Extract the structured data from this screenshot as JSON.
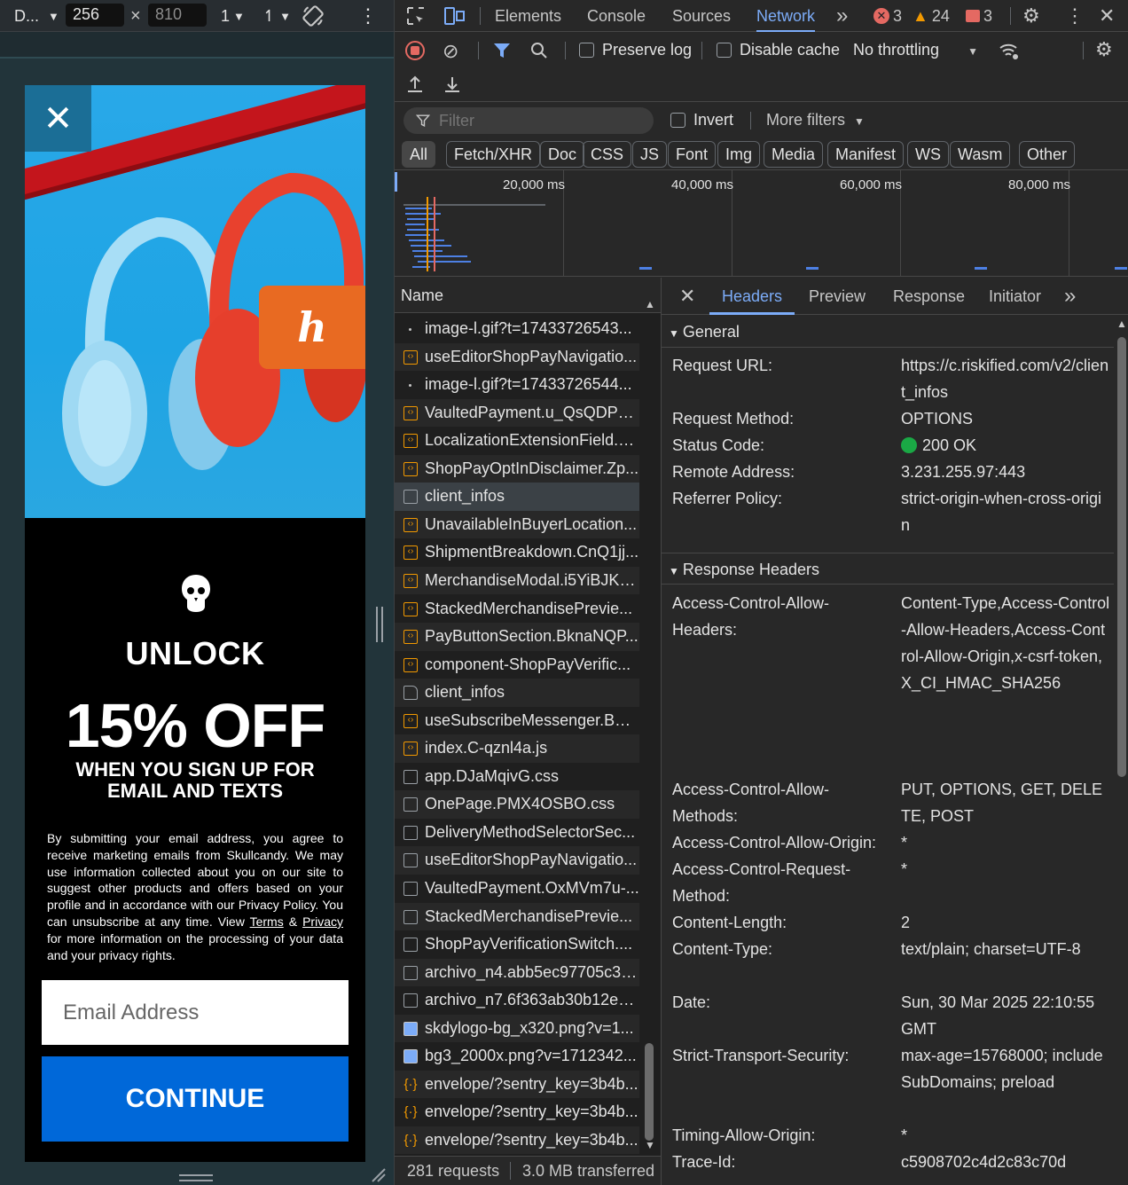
{
  "device_toolbar": {
    "device": "D...",
    "width": "256",
    "height": "810",
    "zoom": "1",
    "throttle": "↿"
  },
  "promo": {
    "close": "✕",
    "unlock": "UNLOCK",
    "offer": "15% OFF",
    "signup_line1": "WHEN YOU SIGN UP FOR",
    "signup_line2": "EMAIL AND TEXTS",
    "legal_part1": "By submitting your email address, you agree to receive marketing emails from Skullcandy. We may use information collected about you on our site to suggest other products and offers based on your profile and in accordance with our Privacy Policy. You can unsubscribe at any time. View ",
    "terms": "Terms",
    "amp": " & ",
    "privacy": "Privacy",
    "legal_part2": " for more information on the processing of your data and your privacy rights.",
    "email_placeholder": "Email Address",
    "continue": "CONTINUE",
    "honey_logo": "h"
  },
  "tabs": {
    "elements": "Elements",
    "console": "Console",
    "sources": "Sources",
    "network": "Network",
    "more": "»",
    "errors": "3",
    "warnings": "24",
    "issues": "3"
  },
  "toolbar": {
    "preserve_log": "Preserve log",
    "disable_cache": "Disable cache",
    "throttling": "No throttling"
  },
  "filter": {
    "placeholder": "Filter",
    "invert": "Invert",
    "more_filters": "More filters"
  },
  "chips": [
    "All",
    "Fetch/XHR",
    "Doc",
    "CSS",
    "JS",
    "Font",
    "Img",
    "Media",
    "Manifest",
    "WS",
    "Wasm",
    "Other"
  ],
  "timeline": {
    "labels": [
      "20,000 ms",
      "40,000 ms",
      "60,000 ms",
      "80,000 ms"
    ]
  },
  "request_list": {
    "header": "Name",
    "items": [
      {
        "name": "image-l.gif?t=17433726543...",
        "type": "dot"
      },
      {
        "name": "useEditorShopPayNavigatio...",
        "type": "script"
      },
      {
        "name": "image-l.gif?t=17433726544...",
        "type": "dot"
      },
      {
        "name": "VaultedPayment.u_QsQDPg.js",
        "type": "script"
      },
      {
        "name": "LocalizationExtensionField.D...",
        "type": "script"
      },
      {
        "name": "ShopPayOptInDisclaimer.Zp...",
        "type": "script"
      },
      {
        "name": "client_infos",
        "type": "doc"
      },
      {
        "name": "UnavailableInBuyerLocation...",
        "type": "script"
      },
      {
        "name": "ShipmentBreakdown.CnQ1jj...",
        "type": "script"
      },
      {
        "name": "MerchandiseModal.i5YiBJKZ...",
        "type": "script"
      },
      {
        "name": "StackedMerchandisePrevie...",
        "type": "script"
      },
      {
        "name": "PayButtonSection.BknaNQP...",
        "type": "script"
      },
      {
        "name": "component-ShopPayVerific...",
        "type": "script"
      },
      {
        "name": "client_infos",
        "type": "file"
      },
      {
        "name": "useSubscribeMessenger.BC...",
        "type": "script"
      },
      {
        "name": "index.C-qznl4a.js",
        "type": "script"
      },
      {
        "name": "app.DJaMqivG.css",
        "type": "doc"
      },
      {
        "name": "OnePage.PMX4OSBO.css",
        "type": "doc"
      },
      {
        "name": "DeliveryMethodSelectorSec...",
        "type": "doc"
      },
      {
        "name": "useEditorShopPayNavigatio...",
        "type": "doc"
      },
      {
        "name": "VaultedPayment.OxMVm7u-...",
        "type": "doc"
      },
      {
        "name": "StackedMerchandisePrevie...",
        "type": "doc"
      },
      {
        "name": "ShopPayVerificationSwitch....",
        "type": "doc"
      },
      {
        "name": "archivo_n4.abb5ec97705c33...",
        "type": "doc"
      },
      {
        "name": "archivo_n7.6f363ab30b12ea...",
        "type": "doc"
      },
      {
        "name": "skdylogo-bg_x320.png?v=1...",
        "type": "img"
      },
      {
        "name": "bg3_2000x.png?v=1712342...",
        "type": "img"
      },
      {
        "name": "envelope/?sentry_key=3b4b...",
        "type": "json"
      },
      {
        "name": "envelope/?sentry_key=3b4b...",
        "type": "json"
      },
      {
        "name": "envelope/?sentry_key=3b4b...",
        "type": "json"
      }
    ]
  },
  "status": {
    "requests": "281 requests",
    "transferred": "3.0 MB transferred"
  },
  "detail_tabs": {
    "close": "✕",
    "headers": "Headers",
    "preview": "Preview",
    "response": "Response",
    "initiator": "Initiator",
    "more": "»"
  },
  "general": {
    "title": "General",
    "rows": [
      {
        "k": "Request URL:",
        "v": "https://c.riskified.com/v2/client_infos"
      },
      {
        "k": "Request Method:",
        "v": "OPTIONS"
      },
      {
        "k": "Status Code:",
        "v": "200 OK"
      },
      {
        "k": "Remote Address:",
        "v": "3.231.255.97:443"
      },
      {
        "k": "Referrer Policy:",
        "v": "strict-origin-when-cross-origin"
      }
    ]
  },
  "response_headers": {
    "title": "Response Headers",
    "rows": [
      {
        "k": "Access-Control-Allow-Headers:",
        "v": "Content-Type,Access-Control-Allow-Headers,Access-Control-Allow-Origin,x-csrf-token,X_CI_HMAC_SHA256"
      },
      {
        "k": "Access-Control-Allow-Methods:",
        "v": "PUT, OPTIONS, GET, DELETE, POST"
      },
      {
        "k": "Access-Control-Allow-Origin:",
        "v": "*"
      },
      {
        "k": "Access-Control-Request-Method:",
        "v": "*"
      },
      {
        "k": "Content-Length:",
        "v": "2"
      },
      {
        "k": "Content-Type:",
        "v": "text/plain; charset=UTF-8"
      },
      {
        "k": "Date:",
        "v": "Sun, 30 Mar 2025 22:10:55 GMT"
      },
      {
        "k": "Strict-Transport-Security:",
        "v": "max-age=15768000; includeSubDomains; preload"
      },
      {
        "k": "Timing-Allow-Origin:",
        "v": "*"
      },
      {
        "k": "Trace-Id:",
        "v": "c5908702c4d2c83c70d"
      }
    ]
  },
  "colors": {
    "accent": "#7cacf8",
    "error": "#e46962",
    "warning": "#f29900",
    "ok": "#1aa845",
    "continue_button": "#0068d9"
  }
}
